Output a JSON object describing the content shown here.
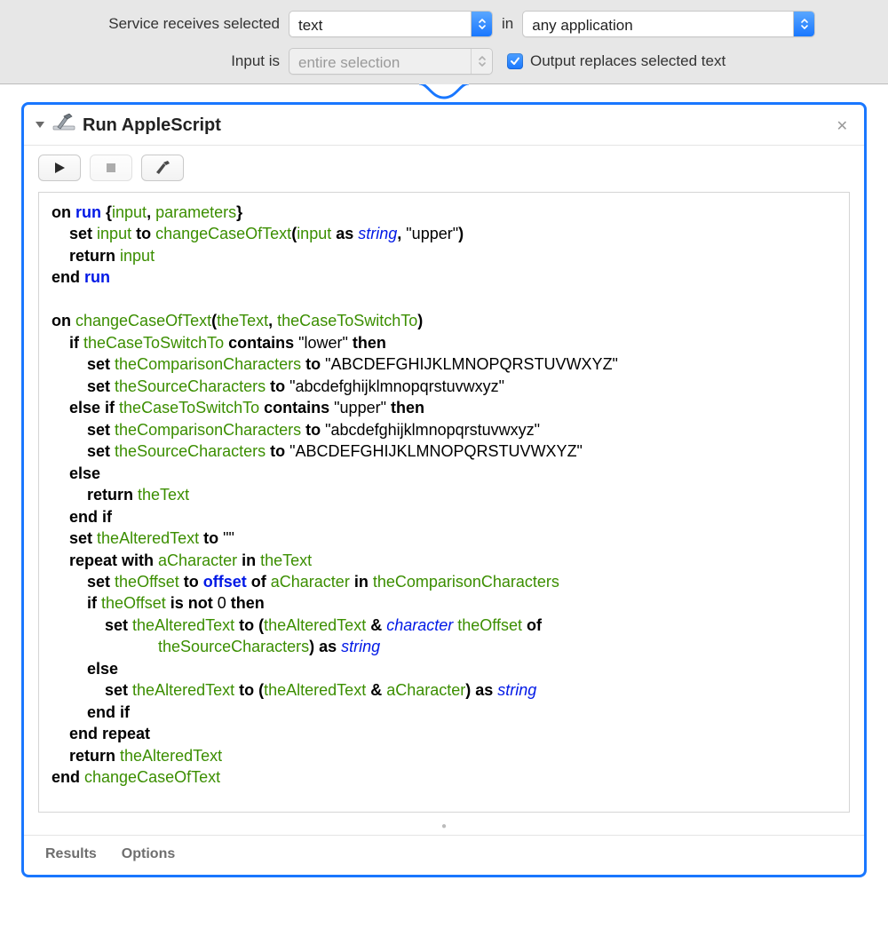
{
  "topbar": {
    "row1_label": "Service receives selected",
    "select_type": "text",
    "in_word": "in",
    "select_app": "any application",
    "row2_label": "Input is",
    "input_is": "entire selection",
    "checkbox_checked": true,
    "checkbox_label": "Output replaces selected text"
  },
  "panel": {
    "title": "Run AppleScript",
    "footer": {
      "results": "Results",
      "options": "Options"
    }
  },
  "code": {
    "l01_on": "on ",
    "l01_run": "run ",
    "l01_br1": "{",
    "l01_input": "input",
    "l01_comma": ", ",
    "l01_params": "parameters",
    "l01_br2": "}",
    "l02_set": "set ",
    "l02_input": "input",
    "l02_to": " to ",
    "l02_fn": "changeCaseOfText",
    "l02_p1": "(",
    "l02_arg1": "input",
    "l02_as": " as ",
    "l02_cls": "string",
    "l02_c": ", ",
    "l02_str": "\"upper\"",
    "l02_p2": ")",
    "l03_ret": "return ",
    "l03_val": "input",
    "l04_end": "end ",
    "l04_run": "run",
    "l06_on": "on ",
    "l06_fn": "changeCaseOfText",
    "l06_p1": "(",
    "l06_a1": "theText",
    "l06_c": ", ",
    "l06_a2": "theCaseToSwitchTo",
    "l06_p2": ")",
    "l07_if": "if ",
    "l07_v": "theCaseToSwitchTo",
    "l07_contains": " contains ",
    "l07_s": "\"lower\"",
    "l07_then": " then",
    "l08_set": "set ",
    "l08_v": "theComparisonCharacters",
    "l08_to": " to ",
    "l08_s": "\"ABCDEFGHIJKLMNOPQRSTUVWXYZ\"",
    "l09_set": "set ",
    "l09_v": "theSourceCharacters",
    "l09_to": " to ",
    "l09_s": "\"abcdefghijklmnopqrstuvwxyz\"",
    "l10_elseif": "else if ",
    "l10_v": "theCaseToSwitchTo",
    "l10_contains": " contains ",
    "l10_s": "\"upper\"",
    "l10_then": " then",
    "l11_set": "set ",
    "l11_v": "theComparisonCharacters",
    "l11_to": " to ",
    "l11_s": "\"abcdefghijklmnopqrstuvwxyz\"",
    "l12_set": "set ",
    "l12_v": "theSourceCharacters",
    "l12_to": " to ",
    "l12_s": "\"ABCDEFGHIJKLMNOPQRSTUVWXYZ\"",
    "l13_else": "else",
    "l14_ret": "return ",
    "l14_v": "theText",
    "l15_endif": "end if",
    "l16_set": "set ",
    "l16_v": "theAlteredText",
    "l16_to": " to ",
    "l16_s": "\"\"",
    "l17_rep": "repeat with ",
    "l17_v1": "aCharacter",
    "l17_in": " in ",
    "l17_v2": "theText",
    "l18_set": "set ",
    "l18_v": "theOffset",
    "l18_to": " to ",
    "l18_off": "offset",
    "l18_of": " of ",
    "l18_v2": "aCharacter",
    "l18_in": " in ",
    "l18_v3": "theComparisonCharacters",
    "l19_if": "if ",
    "l19_v": "theOffset",
    "l19_isnot": " is not ",
    "l19_z": "0",
    "l19_then": " then",
    "l20_set": "set ",
    "l20_v": "theAlteredText",
    "l20_to": " to ",
    "l20_p1": "(",
    "l20_v2": "theAlteredText",
    "l20_amp": " & ",
    "l20_cls": "character",
    "l20_sp": " ",
    "l20_v3": "theOffset",
    "l20_of": " of",
    "l21_v": "theSourceCharacters",
    "l21_p2": ")",
    "l21_as": " as ",
    "l21_cls": "string",
    "l22_else": "else",
    "l23_set": "set ",
    "l23_v": "theAlteredText",
    "l23_to": " to ",
    "l23_p1": "(",
    "l23_v2": "theAlteredText",
    "l23_amp": " & ",
    "l23_v3": "aCharacter",
    "l23_p2": ")",
    "l23_as": " as ",
    "l23_cls": "string",
    "l24_endif": "end if",
    "l25_endrep": "end repeat",
    "l26_ret": "return ",
    "l26_v": "theAlteredText",
    "l27_end": "end ",
    "l27_fn": "changeCaseOfText"
  }
}
